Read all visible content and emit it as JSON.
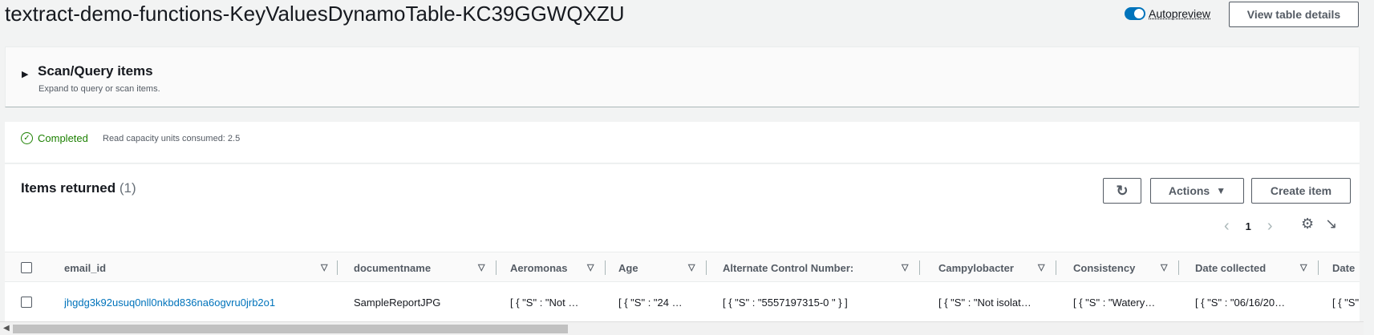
{
  "page": {
    "title": "textract-demo-functions-KeyValuesDynamoTable-KC39GGWQXZU"
  },
  "header": {
    "autopreview_label": "Autopreview",
    "view_table_details": "View table details"
  },
  "scan": {
    "title": "Scan/Query items",
    "subtitle": "Expand to query or scan items."
  },
  "status": {
    "label": "Completed",
    "rcu": "Read capacity units consumed: 2.5"
  },
  "items": {
    "title": "Items returned",
    "count": "(1)",
    "actions_label": "Actions",
    "create_label": "Create item",
    "page": "1"
  },
  "table": {
    "columns": [
      "email_id",
      "documentname",
      "Aeromonas",
      "Age",
      "Alternate Control Number:",
      "Campylobacter",
      "Consistency",
      "Date collected",
      "Date"
    ],
    "rows": [
      {
        "email_id": "jhgdg3k92usuq0nll0nkbd836na6ogvru0jrb2o1",
        "documentname": "SampleReportJPG",
        "aeromonas": "[ { \"S\" : \"Not …",
        "age": "[ { \"S\" : \"24 …",
        "alt_control": "[ { \"S\" : \"5557197315-0 \" } ]",
        "campylobacter": "[ { \"S\" : \"Not isolat…",
        "consistency": "[ { \"S\" : \"Watery…",
        "date_collected": "[ { \"S\" : \"06/16/20…",
        "date": "[ { \"S\""
      }
    ]
  },
  "icons": {
    "refresh": "refresh-icon",
    "settings": "gear-icon",
    "collapse": "collapse-icon"
  },
  "colors": {
    "accent": "#0073bb",
    "success": "#1d8102"
  }
}
